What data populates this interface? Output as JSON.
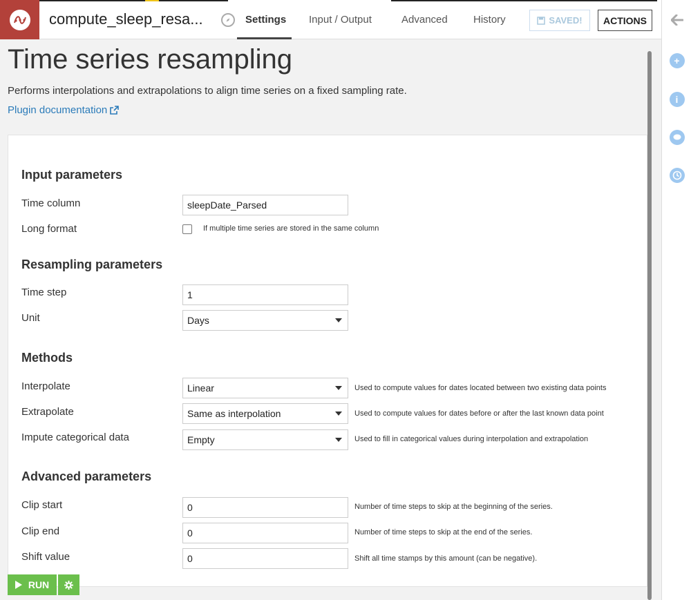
{
  "header": {
    "recipe_name": "compute_sleep_resa...",
    "tabs": [
      {
        "label": "Settings"
      },
      {
        "label": "Input / Output"
      },
      {
        "label": "Advanced"
      },
      {
        "label": "History"
      }
    ],
    "saved_label": "SAVED!",
    "actions_label": "ACTIONS"
  },
  "page": {
    "title": "Time series resampling",
    "description": "Performs interpolations and extrapolations to align time series on a fixed sampling rate.",
    "doc_link": "Plugin documentation"
  },
  "form": {
    "input_section": "Input parameters",
    "time_column": {
      "label": "Time column",
      "value": "sleepDate_Parsed"
    },
    "long_format": {
      "label": "Long format",
      "help": "If multiple time series are stored in the same column",
      "checked": false
    },
    "resampling_section": "Resampling parameters",
    "time_step": {
      "label": "Time step",
      "value": "1"
    },
    "unit": {
      "label": "Unit",
      "value": "Days"
    },
    "methods_section": "Methods",
    "interpolate": {
      "label": "Interpolate",
      "value": "Linear",
      "help": "Used to compute values for dates located between two existing data points"
    },
    "extrapolate": {
      "label": "Extrapolate",
      "value": "Same as interpolation",
      "help": "Used to compute values for dates before or after the last known data point"
    },
    "impute": {
      "label": "Impute categorical data",
      "value": "Empty",
      "help": "Used to fill in categorical values during interpolation and extrapolation"
    },
    "advanced_section": "Advanced parameters",
    "clip_start": {
      "label": "Clip start",
      "value": "0",
      "help": "Number of time steps to skip at the beginning of the series."
    },
    "clip_end": {
      "label": "Clip end",
      "value": "0",
      "help": "Number of time steps to skip at the end of the series."
    },
    "shift_value": {
      "label": "Shift value",
      "value": "0",
      "help": "Shift all time stamps by this amount (can be negative)."
    }
  },
  "footer": {
    "run_label": "RUN"
  },
  "icons": {
    "logo": "resampling-plugin-icon",
    "back": "arrow-left-icon",
    "rail": [
      "plus-icon",
      "info-icon",
      "chat-icon",
      "clock-icon"
    ]
  },
  "colors": {
    "brand": "#b3413a",
    "run": "#6bbf4c",
    "link": "#2b7bb9",
    "rail_icon": "#9ec8f0"
  }
}
